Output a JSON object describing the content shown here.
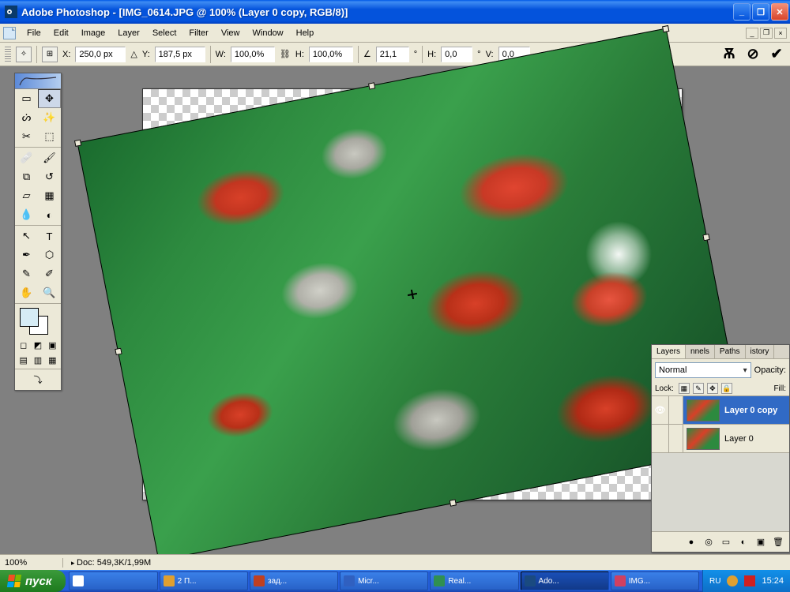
{
  "titlebar": {
    "app": "Adobe Photoshop",
    "doc": "[IMG_0614.JPG @ 100% (Layer 0 copy, RGB/8)]"
  },
  "menu": [
    "File",
    "Edit",
    "Image",
    "Layer",
    "Select",
    "Filter",
    "View",
    "Window",
    "Help"
  ],
  "options": {
    "x_label": "X:",
    "x": "250,0 px",
    "y_label": "Y:",
    "y": "187,5 px",
    "w_label": "W:",
    "w": "100,0%",
    "h_label": "H:",
    "h": "100,0%",
    "angle_label": "∠",
    "angle": "21,1",
    "deg": "°",
    "skew_h_label": "H:",
    "skew_h": "0,0",
    "skew_v_label": "V:",
    "skew_v": "0,0"
  },
  "status": {
    "zoom": "100%",
    "doc_label": "Doc:",
    "doc_size": "549,3K/1,99M"
  },
  "layers_panel": {
    "tabs": [
      "Layers",
      "nnels",
      "Paths",
      "istory"
    ],
    "blend_mode": "Normal",
    "opacity_label": "Opacity:",
    "lock_label": "Lock:",
    "fill_label": "Fill:",
    "layers": [
      {
        "name": "Layer 0 copy",
        "visible": true,
        "selected": true
      },
      {
        "name": "Layer 0",
        "visible": false,
        "selected": false
      }
    ]
  },
  "taskbar": {
    "start": "пуск",
    "items": [
      {
        "label": "",
        "active": false
      },
      {
        "label": "2 П...",
        "active": false
      },
      {
        "label": "зад...",
        "active": false
      },
      {
        "label": "Micr...",
        "active": false
      },
      {
        "label": "Real...",
        "active": false
      },
      {
        "label": "Ado...",
        "active": true
      },
      {
        "label": "IMG...",
        "active": false
      }
    ],
    "lang": "RU",
    "time": "15:24"
  }
}
